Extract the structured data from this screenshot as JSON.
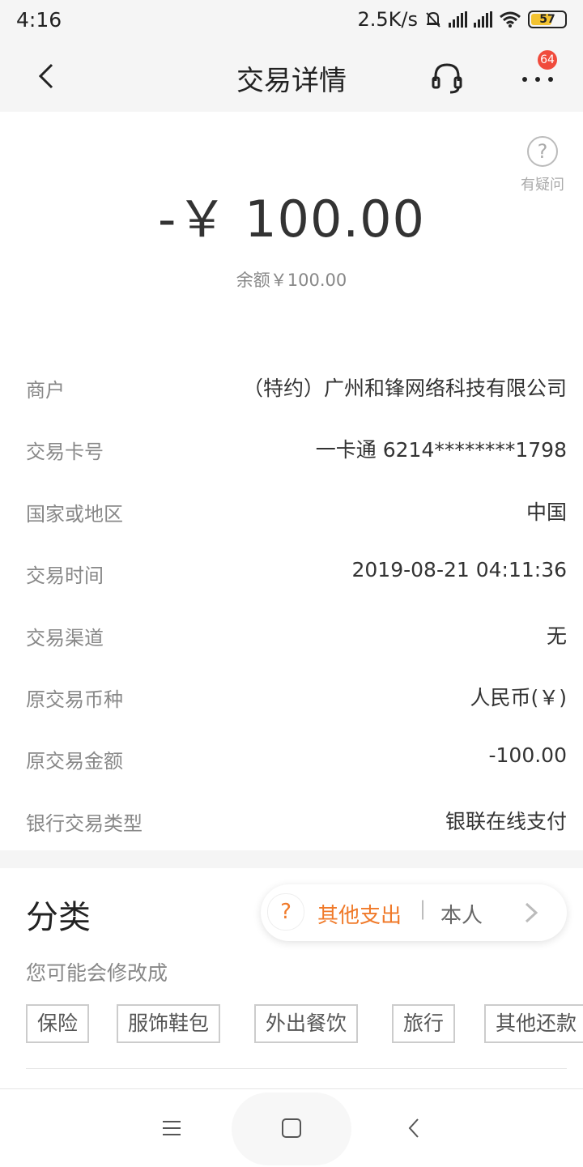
{
  "status_bar": {
    "time": "4:16",
    "net_speed": "2.5K/s",
    "battery": "57",
    "icons": [
      "mute-bell-icon",
      "signal-icon",
      "signal-icon",
      "wifi-icon",
      "battery-icon"
    ]
  },
  "nav": {
    "title": "交易详情",
    "badge_count": "64",
    "icons": [
      "back-icon",
      "headset-icon",
      "more-icon"
    ]
  },
  "summary": {
    "amount": "-￥ 100.00",
    "balance": "余额￥100.00",
    "help_label": "有疑问",
    "help_icon_text": "?"
  },
  "details": [
    {
      "label": "商户",
      "value": "（特约）广州和锋网络科技有限公司"
    },
    {
      "label": "交易卡号",
      "value": "一卡通 6214********1798"
    },
    {
      "label": "国家或地区",
      "value": "中国"
    },
    {
      "label": "交易时间",
      "value": "2019-08-21 04:11:36"
    },
    {
      "label": "交易渠道",
      "value": "无"
    },
    {
      "label": "原交易币种",
      "value": "人民币(￥)"
    },
    {
      "label": "原交易金额",
      "value": "-100.00"
    },
    {
      "label": "银行交易类型",
      "value": "银联在线支付"
    }
  ],
  "category": {
    "heading": "分类",
    "selected_category": "其他支出",
    "separator": "|",
    "person": "本人",
    "question_icon_text": "?",
    "hint": "您可能会修改成",
    "suggestions": [
      "保险",
      "服饰鞋包",
      "外出餐饮",
      "旅行",
      "其他还款"
    ],
    "accent_color": "#f07a2a"
  },
  "system_nav": {
    "icons": [
      "menu-icon",
      "home-icon",
      "back-triangle-icon"
    ]
  }
}
